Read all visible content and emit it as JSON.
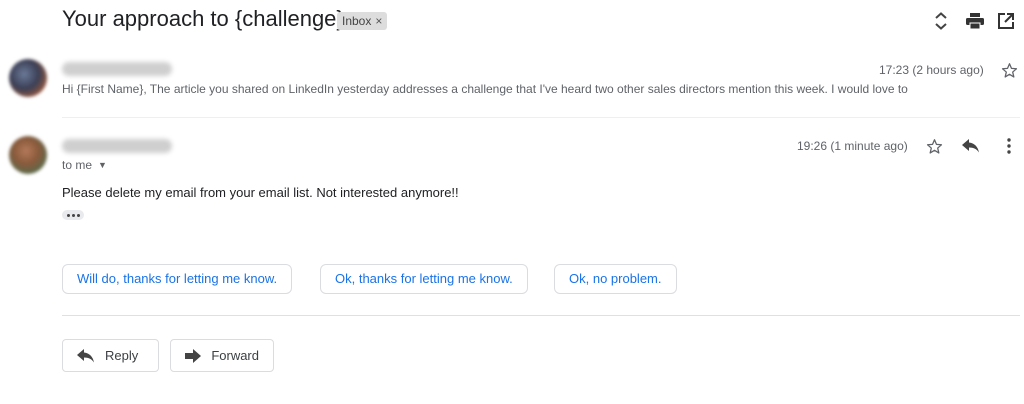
{
  "header": {
    "subject": "Your approach to {challenge}",
    "label_chip": "Inbox",
    "label_remove": "×"
  },
  "messages": [
    {
      "time": "17:23 (2 hours ago)",
      "snippet": "Hi {First Name}, The article you shared on LinkedIn yesterday addresses a challenge that I've heard two other sales directors mention this week. I would love to"
    },
    {
      "time": "19:26 (1 minute ago)",
      "recipient": "to me",
      "body": "Please delete my email from your email list. Not interested anymore!!"
    }
  ],
  "smart_replies": [
    "Will do, thanks for letting me know.",
    "Ok, thanks for letting me know.",
    "Ok, no problem."
  ],
  "actions": {
    "reply": "Reply",
    "forward": "Forward"
  },
  "icons": {
    "expand": "unfold-icon",
    "print": "print-icon",
    "open_new": "open-in-new-icon",
    "star": "star-icon",
    "reply": "reply-icon",
    "more": "more-vert-icon",
    "forward": "forward-icon"
  },
  "colors": {
    "accent": "#1a73e8",
    "text": "#202124",
    "muted": "#5f6368",
    "border": "#dadce0"
  }
}
